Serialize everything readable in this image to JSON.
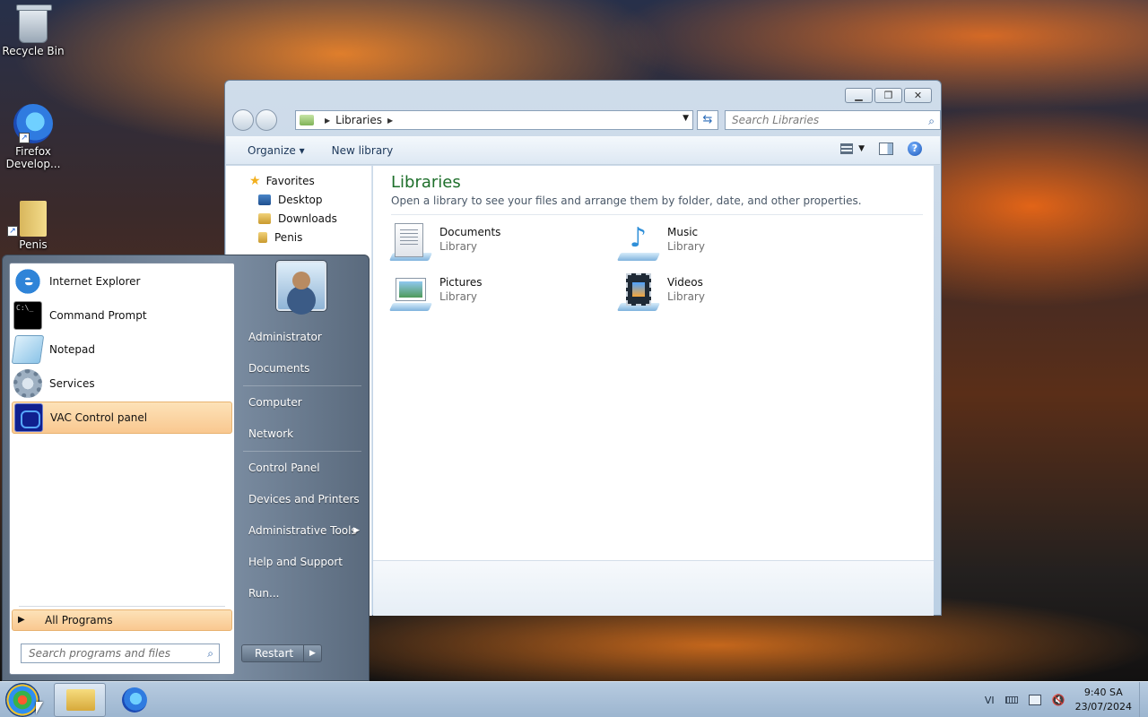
{
  "desktop": {
    "icons": [
      {
        "label": "Recycle Bin"
      },
      {
        "label": "Firefox Develop..."
      },
      {
        "label": "Penis"
      }
    ]
  },
  "explorer": {
    "address": {
      "crumb": "Libraries"
    },
    "search_placeholder": "Search Libraries",
    "toolbar": {
      "organize": "Organize",
      "new_library": "New library"
    },
    "nav": {
      "favorites": "Favorites",
      "items": [
        "Desktop",
        "Downloads",
        "Penis"
      ]
    },
    "content": {
      "title": "Libraries",
      "subtitle": "Open a library to see your files and arrange them by folder, date, and other properties.",
      "libraries": [
        {
          "name": "Documents",
          "kind": "Library",
          "icon": "documents-icon"
        },
        {
          "name": "Music",
          "kind": "Library",
          "icon": "music-icon"
        },
        {
          "name": "Pictures",
          "kind": "Library",
          "icon": "pictures-icon"
        },
        {
          "name": "Videos",
          "kind": "Library",
          "icon": "videos-icon"
        }
      ]
    }
  },
  "start_menu": {
    "programs": [
      {
        "label": "Internet Explorer",
        "icon": "internet-explorer-icon"
      },
      {
        "label": "Command Prompt",
        "icon": "command-prompt-icon"
      },
      {
        "label": "Notepad",
        "icon": "notepad-icon"
      },
      {
        "label": "Services",
        "icon": "services-icon"
      },
      {
        "label": "VAC Control panel",
        "icon": "vac-control-panel-icon",
        "highlighted": true
      }
    ],
    "all_programs": "All Programs",
    "search_placeholder": "Search programs and files",
    "right": {
      "user": "Administrator",
      "documents": "Documents",
      "computer": "Computer",
      "network": "Network",
      "control_panel": "Control Panel",
      "devices": "Devices and Printers",
      "admin_tools": "Administrative Tools",
      "help": "Help and Support",
      "run": "Run..."
    },
    "restart": "Restart"
  },
  "taskbar": {
    "language": "VI",
    "time": "9:40 SA",
    "date": "23/07/2024"
  },
  "colors": {
    "highlight": "#f9c890",
    "library_title": "#1e6f2b"
  }
}
